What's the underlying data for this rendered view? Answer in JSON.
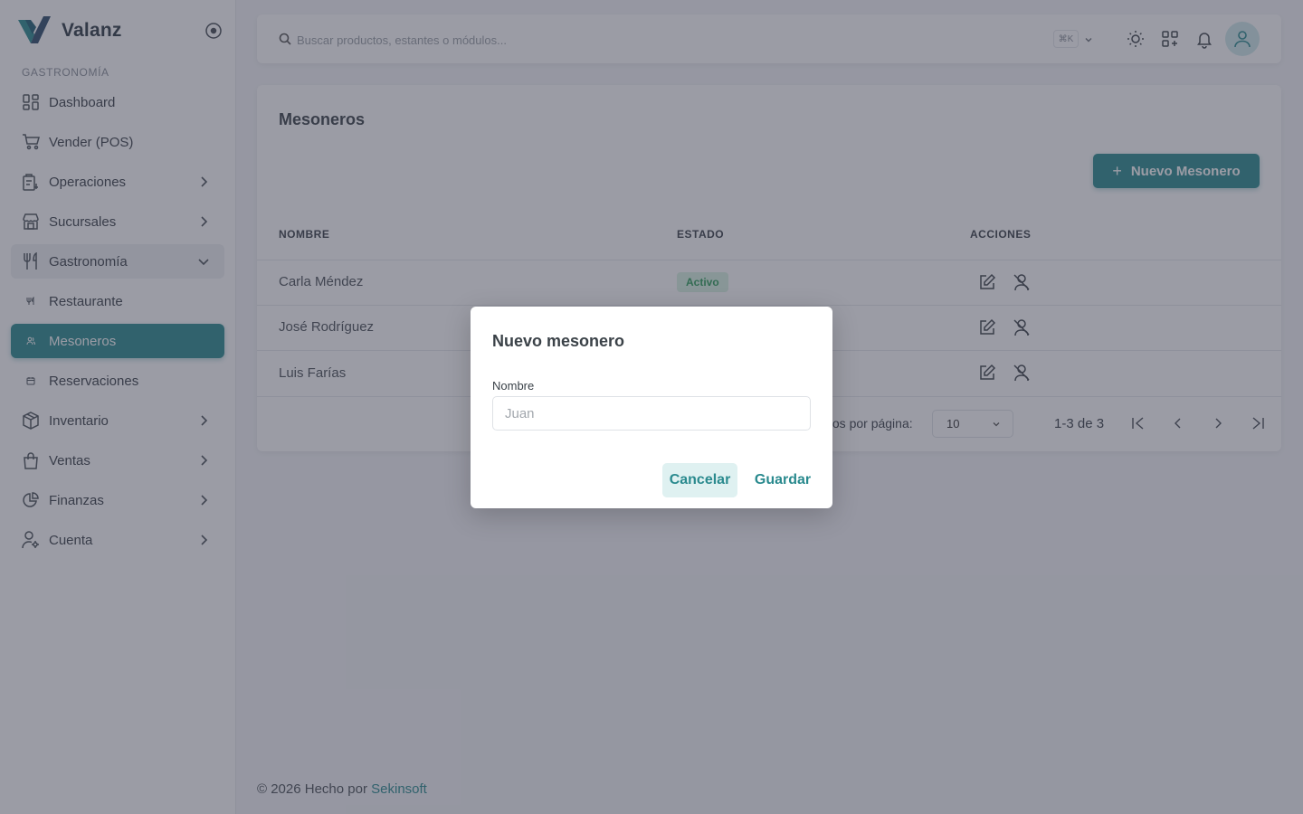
{
  "brand": {
    "name": "Valanz",
    "logo_icon": "valanz-logo-icon"
  },
  "sidebar": {
    "section_label": "GASTRONOMÍA",
    "items": [
      {
        "label": "Dashboard",
        "icon": "dashboard-icon"
      },
      {
        "label": "Vender (POS)",
        "icon": "cart-icon"
      },
      {
        "label": "Operaciones",
        "icon": "operations-icon",
        "expandable": true
      },
      {
        "label": "Sucursales",
        "icon": "store-icon",
        "expandable": true
      },
      {
        "label": "Gastronomía",
        "icon": "utensils-icon",
        "expandable": true,
        "open": true
      },
      {
        "label": "Restaurante",
        "icon": "utensils-small-icon",
        "sub": true
      },
      {
        "label": "Mesoneros",
        "icon": "users-small-icon",
        "sub": true,
        "active": true
      },
      {
        "label": "Reservaciones",
        "icon": "calendar-small-icon",
        "sub": true
      },
      {
        "label": "Inventario",
        "icon": "box-icon",
        "expandable": true
      },
      {
        "label": "Ventas",
        "icon": "shopping-bag-icon",
        "expandable": true
      },
      {
        "label": "Finanzas",
        "icon": "pie-chart-icon",
        "expandable": true
      },
      {
        "label": "Cuenta",
        "icon": "user-cog-icon",
        "expandable": true
      }
    ]
  },
  "topbar": {
    "search_placeholder": "Buscar productos, estantes o módulos...",
    "shortcut": "⌘K"
  },
  "page": {
    "title": "Mesoneros",
    "new_button": "Nuevo Mesonero",
    "table": {
      "headers": [
        "NOMBRE",
        "ESTADO",
        "ACCIONES"
      ],
      "rows": [
        {
          "name": "Carla Méndez",
          "status": "Activo"
        },
        {
          "name": "José Rodríguez",
          "status": ""
        },
        {
          "name": "Luis Farías",
          "status": ""
        }
      ]
    },
    "pagination": {
      "per_page_label": "tos por página:",
      "per_page_value": "10",
      "range": "1-3 de 3"
    }
  },
  "footer": {
    "text": "© 2026 Hecho por",
    "link": "Sekinsoft"
  },
  "modal": {
    "title": "Nuevo mesonero",
    "field_label": "Nombre",
    "field_placeholder": "Juan",
    "field_value": "",
    "cancel": "Cancelar",
    "save": "Guardar"
  },
  "colors": {
    "accent": "#2a8a8e",
    "badge_bg": "#d9f2e3",
    "badge_text": "#2f9e5b",
    "overlay": "#373a4b"
  }
}
